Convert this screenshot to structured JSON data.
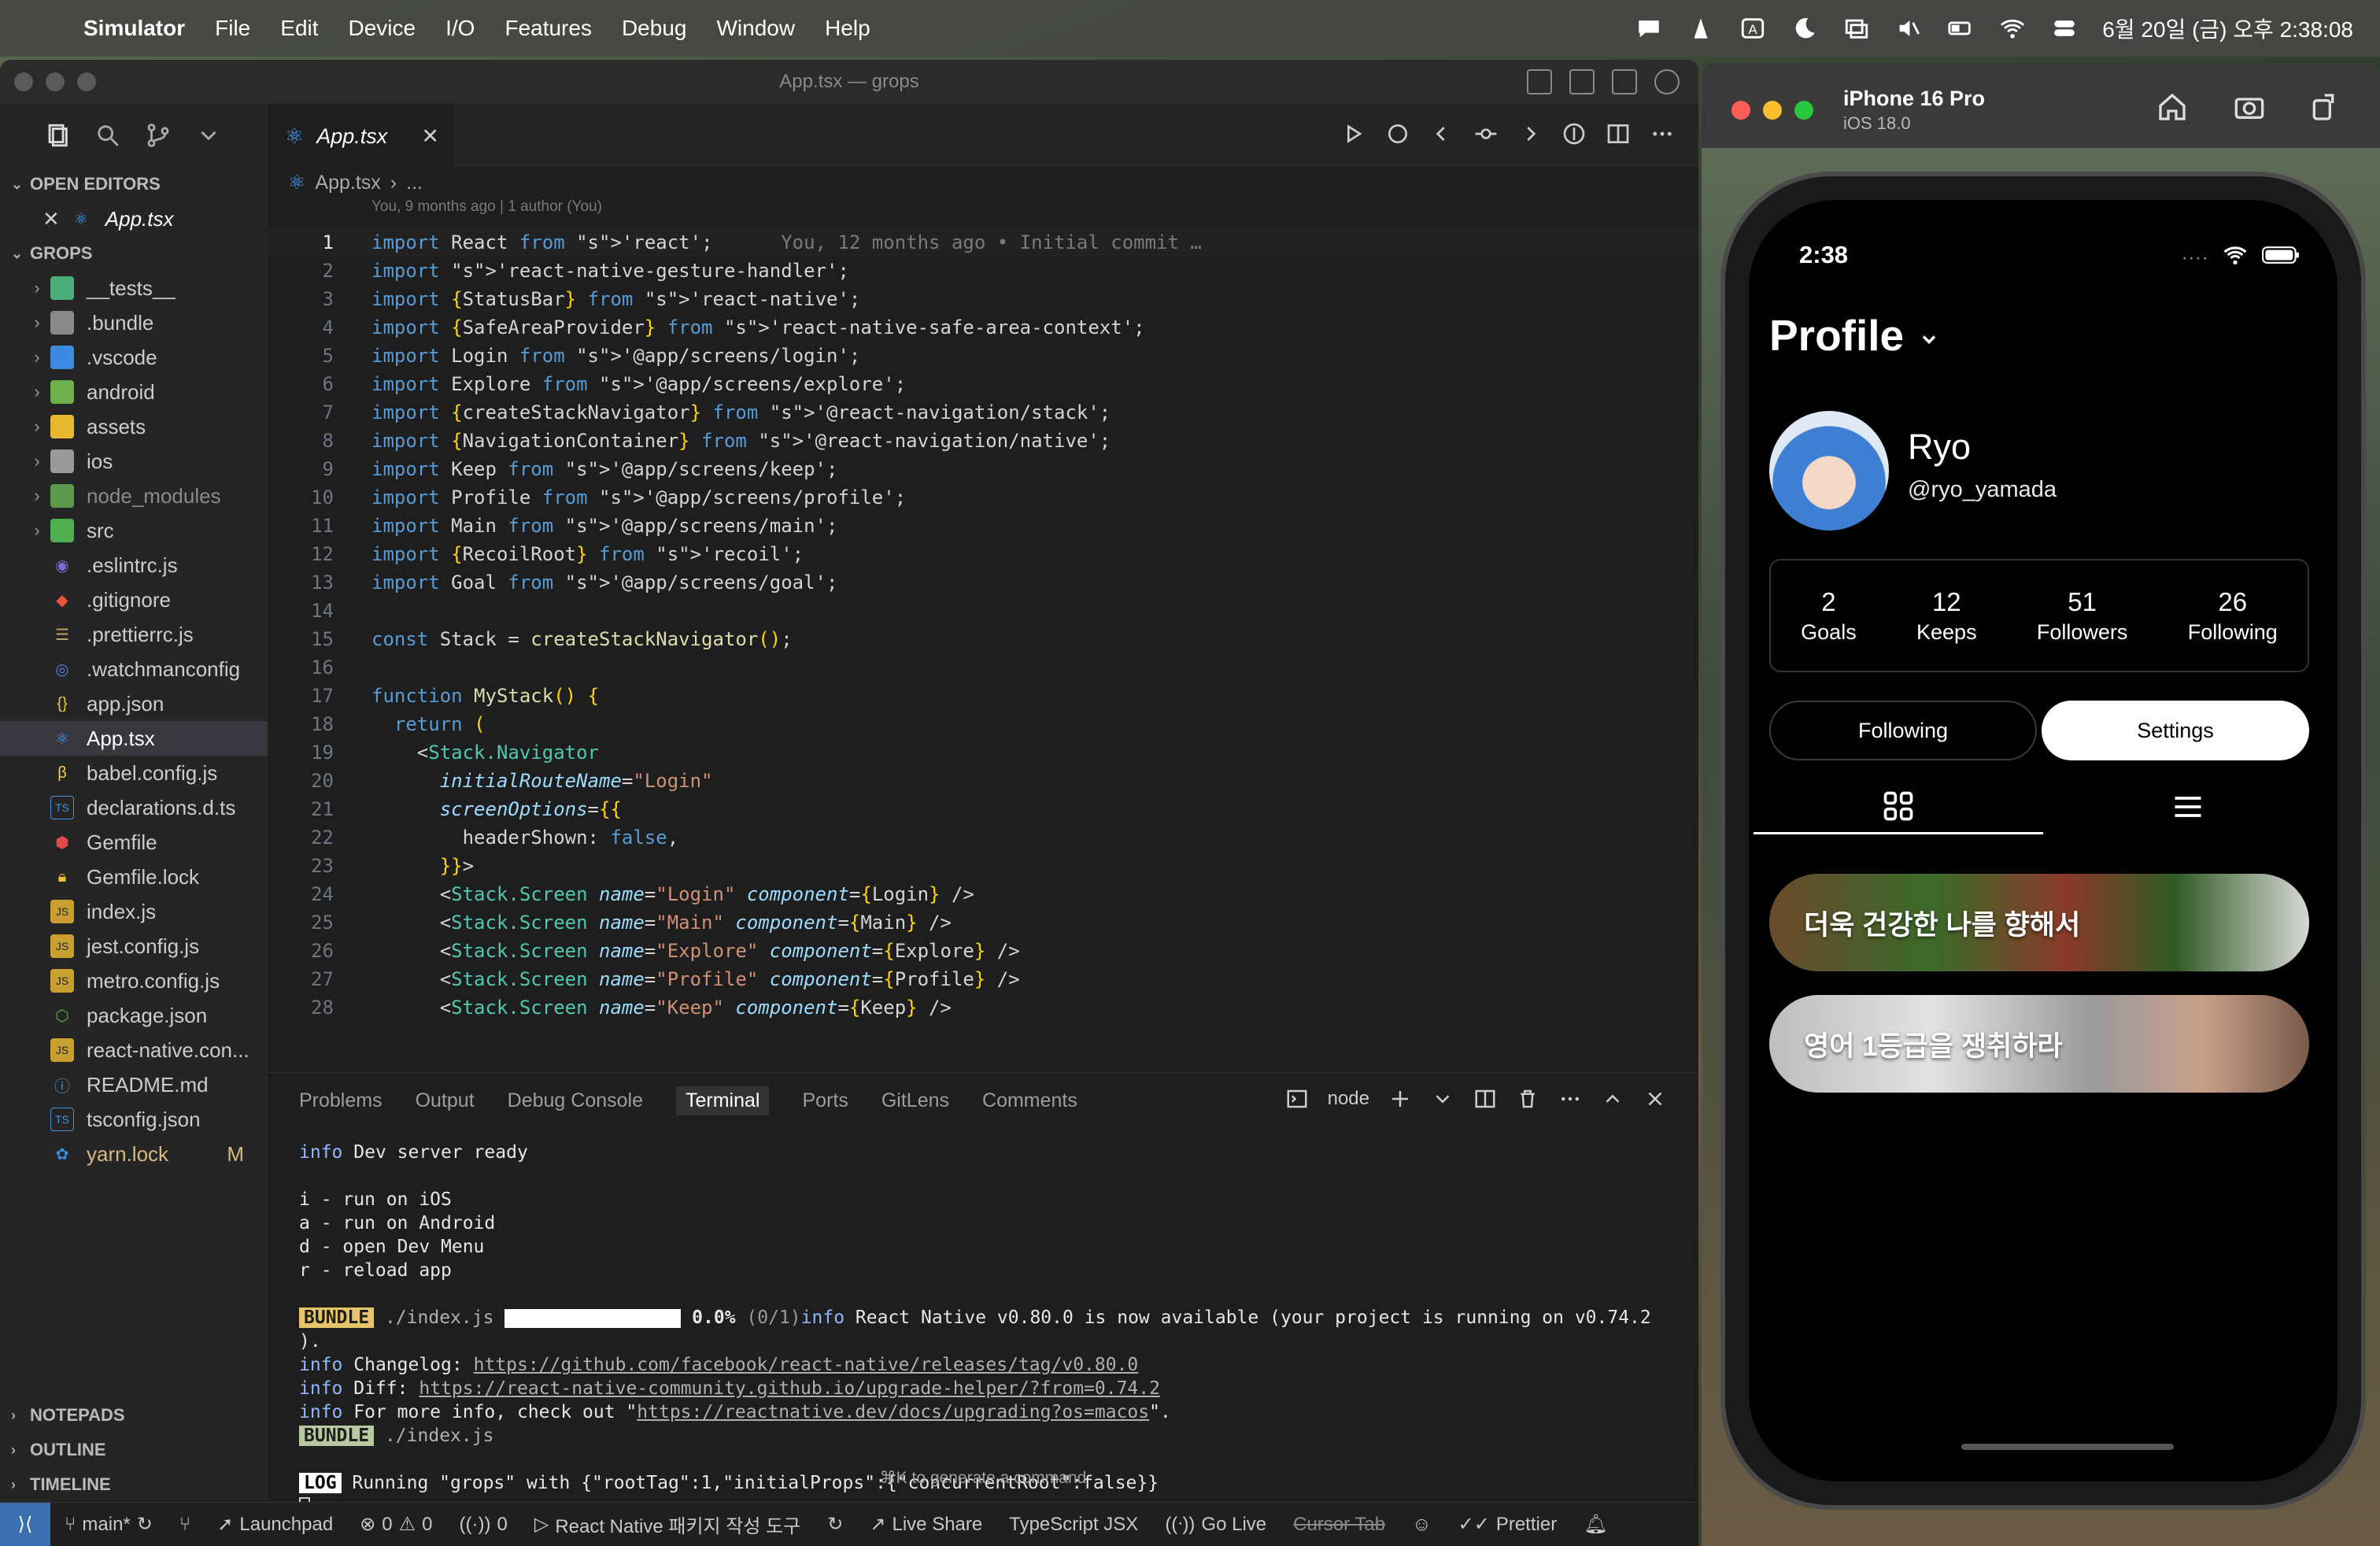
{
  "menubar": {
    "app": "Simulator",
    "items": [
      "File",
      "Edit",
      "Device",
      "I/O",
      "Features",
      "Debug",
      "Window",
      "Help"
    ],
    "clock": "6월 20일 (금) 오후 2:38:08"
  },
  "vscode": {
    "window_title": "App.tsx — grops",
    "sidebar": {
      "open_editors_label": "OPEN EDITORS",
      "open_file": "App.tsx",
      "workspace_label": "GROPS",
      "folders": [
        "__tests__",
        ".bundle",
        ".vscode",
        "android",
        "assets",
        "ios",
        "node_modules",
        "src"
      ],
      "files": [
        ".eslintrc.js",
        ".gitignore",
        ".prettierrc.js",
        ".watchmanconfig",
        "app.json",
        "App.tsx",
        "babel.config.js",
        "declarations.d.ts",
        "Gemfile",
        "Gemfile.lock",
        "index.js",
        "jest.config.js",
        "metro.config.js",
        "package.json",
        "react-native.con...",
        "README.md",
        "tsconfig.json",
        "yarn.lock"
      ],
      "modified_badge": "M",
      "sections": [
        "NOTEPADS",
        "OUTLINE",
        "TIMELINE"
      ]
    },
    "tab": {
      "label": "App.tsx"
    },
    "breadcrumbs": {
      "file": "App.tsx",
      "rest": "..."
    },
    "blame_header": "You, 9 months ago | 1 author (You)",
    "ghost_blame": "You, 12 months ago • Initial commit …",
    "code_lines": [
      "import React from 'react';",
      "import 'react-native-gesture-handler';",
      "import {StatusBar} from 'react-native';",
      "import {SafeAreaProvider} from 'react-native-safe-area-context';",
      "import Login from '@app/screens/login';",
      "import Explore from '@app/screens/explore';",
      "import {createStackNavigator} from '@react-navigation/stack';",
      "import {NavigationContainer} from '@react-navigation/native';",
      "import Keep from '@app/screens/keep';",
      "import Profile from '@app/screens/profile';",
      "import Main from '@app/screens/main';",
      "import {RecoilRoot} from 'recoil';",
      "import Goal from '@app/screens/goal';",
      "",
      "const Stack = createStackNavigator();",
      "",
      "function MyStack() {",
      "  return (",
      "    <Stack.Navigator",
      "      initialRouteName=\"Login\"",
      "      screenOptions={{",
      "        headerShown: false,",
      "      }}>",
      "      <Stack.Screen name=\"Login\" component={Login} />",
      "      <Stack.Screen name=\"Main\" component={Main} />",
      "      <Stack.Screen name=\"Explore\" component={Explore} />",
      "      <Stack.Screen name=\"Profile\" component={Profile} />",
      "      <Stack.Screen name=\"Keep\" component={Keep} />"
    ],
    "panel": {
      "tabs": [
        "Problems",
        "Output",
        "Debug Console",
        "Terminal",
        "Ports",
        "GitLens",
        "Comments"
      ],
      "active_tab": "Terminal",
      "shell_label": "node",
      "terminal": {
        "dev_ready": "Dev server ready",
        "shortcuts": [
          "i - run on iOS",
          "a - run on Android",
          "d - open Dev Menu",
          "r - reload app"
        ],
        "bundle_label": "BUNDLE",
        "bundle_file": "./index.js",
        "bundle_progress": "0.0%",
        "bundle_count": "(0/1)",
        "rn_notice": "React Native v0.80.0 is now available (your project is running on v0.74.2",
        "rn_notice_end": ").",
        "changelog_label": "Changelog:",
        "changelog_url": "https://github.com/facebook/react-native/releases/tag/v0.80.0",
        "diff_label": "Diff:",
        "diff_url": "https://react-native-community.github.io/upgrade-helper/?from=0.74.2",
        "more_info_prefix": "For more info, check out \"",
        "more_info_url": "https://reactnative.dev/docs/upgrading?os=macos",
        "more_info_suffix": "\".",
        "info_tag": "info",
        "log_label": "LOG",
        "log_text": "Running \"grops\" with {\"rootTag\":1,\"initialProps\":{\"concurrentRoot\":false}}"
      },
      "hint": "⌘K to generate a command"
    },
    "statusbar": {
      "branch": "main*",
      "launchpad": "Launchpad",
      "errors": "0",
      "warnings": "0",
      "ports": "0",
      "react_native_tool": "React Native 패키지 작성 도구",
      "live_share": "Live Share",
      "language": "TypeScript JSX",
      "go_live": "Go Live",
      "cursor_tab": "Cursor Tab",
      "prettier": "Prettier"
    }
  },
  "simulator": {
    "device": "iPhone 16 Pro",
    "os": "iOS 18.0",
    "app": {
      "time": "2:38",
      "title": "Profile",
      "name": "Ryo",
      "handle": "@ryo_yamada",
      "stats": [
        {
          "value": "2",
          "label": "Goals"
        },
        {
          "value": "12",
          "label": "Keeps"
        },
        {
          "value": "51",
          "label": "Followers"
        },
        {
          "value": "26",
          "label": "Following"
        }
      ],
      "following_btn": "Following",
      "settings_btn": "Settings",
      "goals": [
        "더욱 건강한 나를 향해서",
        "영어 1등급을 쟁취하라"
      ]
    }
  },
  "colors": {
    "accent": "#3c6fb0",
    "editor_bg": "#1e1e1e",
    "sidebar_bg": "#252526"
  }
}
